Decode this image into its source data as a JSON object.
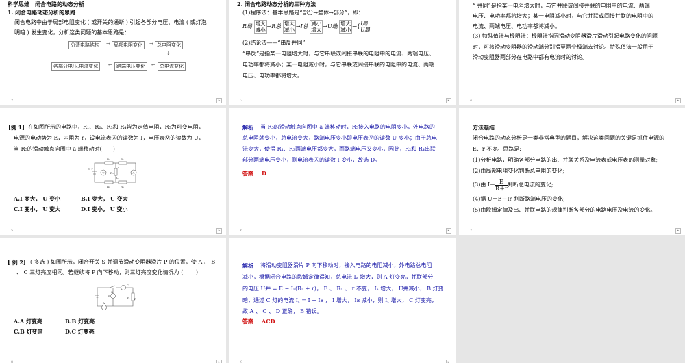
{
  "slides": [
    {
      "page": "2",
      "title": "科学思维　闭合电路的动态分析",
      "heading": "1. 闭合电路动态分析的思路",
      "para": [
        "闭合电路中由于局部电阻变化 ( 或开关的通断 ) 引起各部分电压、电流 ( 或灯泡",
        "明暗 ) 发生变化，分析这类问题的基本思路是："
      ],
      "flow": [
        "分清电路结构",
        "局部电阻变化",
        "总电阻变化",
        "总电流变化",
        "路端电压变化",
        "各部分电压,电流变化"
      ]
    },
    {
      "page": "3",
      "title": "2. 闭合电路动态分析的三种方法",
      "m1": "(1)程序法：基本思路是“部分→整体→部分”，即：",
      "formula": {
        "r_local": "R局",
        "r_total": "R总",
        "i_total": "I总",
        "u_end": "U端",
        "up": "增大",
        "down": "减小",
        "i_local": "I局",
        "u_local": "U局"
      },
      "m2": "(2)结论法——“串反并同”",
      "para": [
        "“串反”是指某一电阻增大时，与它串联或间接串联的电阻中的电流、两端电压、",
        "电功率都将减小；某一电阻减小时，与它串联或间接串联的电阻中的电流、两端",
        "电压、电功率都将增大。"
      ]
    },
    {
      "page": "4",
      "para": [
        "“ 并同”是指某一电阻增大时，与它并联或间接并联的电阻中的电流、两端",
        "电压、电功率都将增大；某一电阻减小时，与它并联或间接并联的电阻中的",
        "电流、两端电压、电功率都将减小。",
        "(3) 特殊值法与极限法：极限法指因滑动变阻器滑片滑动引起电路变化的问题",
        "时，可将滑动变阻器的滑动端分别滑至两个极端去讨论。特殊值法一般用于",
        "滑动变阻器两部分在电路中都有电流时的讨论。"
      ]
    },
    {
      "page": "5",
      "label": "[例 1]",
      "para": [
        "在如图所示的电路中，R₁、R₂、R₃和 R₄皆为定值电阻，R₅为可变电阻，",
        "电源的电动势为 E，内阻为 r，设电流表Ⓐ的读数为 I，电压表Ⓥ的读数为 U，",
        "当 R₅的滑动触点向图中 a 端移动时(　　)"
      ],
      "options": [
        "A.I 变大， U 变小",
        "B.I 变大， U 变大",
        "C.I 变小， U 变大",
        "D.I 变小， U 变小"
      ],
      "circuit_labels": [
        "R₁",
        "R₂",
        "R₃",
        "R₄",
        "R₅",
        "E, r",
        "a",
        "b",
        "V",
        "A"
      ]
    },
    {
      "page": "6",
      "label": "解析",
      "para": [
        "当 R₅的滑动触点向图中 a 端移动时，R₅接入电路的电阻变小，外电路的",
        "总电阻就变小，总电流变大，路端电压变小即电压表Ⓥ的读数 U 变小；由于总电",
        "流变大，使得 R₁、R₃两端电压都变大，而路端电压又变小，因此，R₂和 R₄串联",
        "部分两端电压变小，则电流表Ⓐ的读数 I 变小，故选 D。"
      ],
      "answer_label": "答案",
      "answer": "D"
    },
    {
      "page": "7",
      "title": "方法凝结",
      "para": [
        "闭合电路的动态分析是一类非常典型的题目，解决这类问题的关键是抓住电源的",
        "E、r 不变。思路是:",
        "(1)分析电路，明确各部分电路的串、并联关系及电流表或电压表的测量对象;",
        "(2)由局部电阻变化判断总电阻的变化;"
      ],
      "s3_pre": "(3)由 I＝",
      "s3_num": "E",
      "s3_den": "R＋r",
      "s3_post": "判断总电流的变化;",
      "s4": "(4)据 U＝E－Ir 判断路端电压的变化;",
      "s5": "(5)由欧姆定律及串、并联电路的规律判断各部分的电路电压及电流的变化。"
    },
    {
      "page": "8",
      "label": "[ 例 2]",
      "para": [
        "( 多选 ) 如图所示，闭合开关 S 并调节滑动变阻器滑片 P 的位置，使 A 、 B",
        "、 C 三灯亮度相同。若继续将 P 向下移动，则三灯亮度变化情况为 (　　 )"
      ],
      "options": [
        "A.A 灯变亮",
        "B.B 灯变亮",
        "C.B 灯变暗",
        "D.C 灯变亮"
      ],
      "circuit_labels": [
        "S",
        "C",
        "B",
        "A",
        "R",
        "P"
      ]
    },
    {
      "page": "9",
      "label": "解析",
      "para": [
        "将滑动变阻器滑片 P 向下移动时，接入电路的电阻减小，外电路总电阻",
        "减小，根据闭合电路的欧姆定律得知，总电流 Iₐ 增大，则 A 灯变亮，并联部分",
        "的电压 U并 = E − Iₐ(Rₐ + r)， E 、 Rₐ 、 r 不变， Iₐ 增大， U并减小， B 灯变",
        "暗，通过 C 灯的电流 I꜀ = I − Iʙ ， I 增大， Iʙ 减小，则 I꜀ 增大， C 灯变亮，",
        "故 A 、 C 、 D 正确， B 错误。"
      ],
      "answer_label": "答案",
      "answer": "ACD"
    }
  ],
  "nav_icon": "slide-end-icon"
}
